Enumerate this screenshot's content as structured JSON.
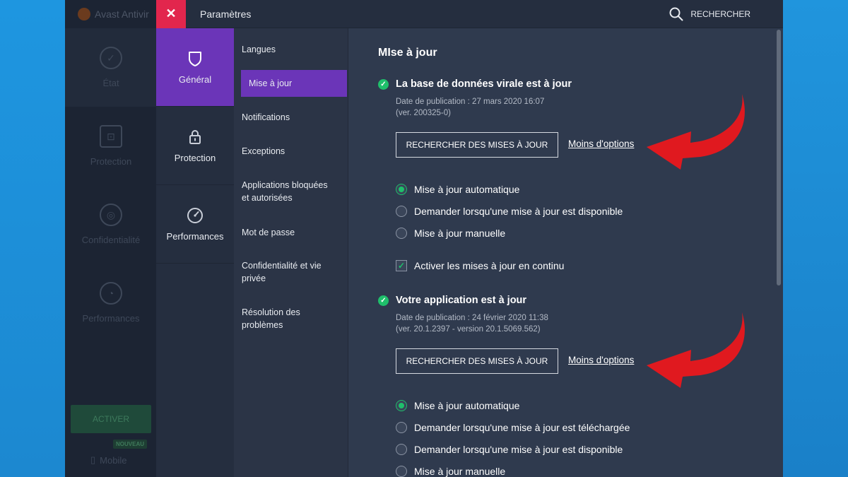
{
  "background_app": {
    "title": "Avast Antivir",
    "nav": [
      {
        "label": "État",
        "icon": "check-circle-icon"
      },
      {
        "label": "Protection",
        "icon": "lock-icon"
      },
      {
        "label": "Confidentialité",
        "icon": "fingerprint-icon"
      },
      {
        "label": "Performances",
        "icon": "speedometer-icon"
      }
    ],
    "activate_label": "ACTIVER",
    "new_badge": "NOUVEAU",
    "mobile_label": "Mobile"
  },
  "settings": {
    "title": "Paramètres",
    "search_label": "RECHERCHER",
    "close_symbol": "✕",
    "categories": [
      {
        "label": "Général",
        "icon": "shield-icon",
        "active": true
      },
      {
        "label": "Protection",
        "icon": "lock-icon",
        "active": false
      },
      {
        "label": "Performances",
        "icon": "speedometer-icon",
        "active": false
      }
    ],
    "subnav": [
      {
        "label": "Langues"
      },
      {
        "label": "Mise à jour",
        "active": true
      },
      {
        "label": "Notifications"
      },
      {
        "label": "Exceptions"
      },
      {
        "label": "Applications bloquées et autorisées"
      },
      {
        "label": "Mot de passe"
      },
      {
        "label": "Confidentialité et vie privée"
      },
      {
        "label": "Résolution des problèmes"
      }
    ],
    "content": {
      "heading": "MIse à jour",
      "virus_db": {
        "status": "La base de données virale est à jour",
        "date": "Date de publication : 27 mars 2020 16:07",
        "version": "(ver. 200325-0)",
        "button": "RECHERCHER DES MISES À JOUR",
        "less_options": "Moins d'options",
        "options": [
          {
            "label": "Mise à jour automatique",
            "selected": true
          },
          {
            "label": "Demander lorsqu'une mise à jour est disponible",
            "selected": false
          },
          {
            "label": "Mise à jour manuelle",
            "selected": false
          }
        ],
        "continuous": {
          "label": "Activer les mises à jour en continu",
          "checked": true
        }
      },
      "application": {
        "status": "Votre application est à jour",
        "date": "Date de publication : 24 février 2020 11:38",
        "version": "(ver. 20.1.2397 - version 20.1.5069.562)",
        "button": "RECHERCHER DES MISES À JOUR",
        "less_options": "Moins d'options",
        "options": [
          {
            "label": "Mise à jour automatique",
            "selected": true
          },
          {
            "label": "Demander lorsqu'une mise à jour est téléchargée",
            "selected": false
          },
          {
            "label": "Demander lorsqu'une mise à jour est disponible",
            "selected": false
          },
          {
            "label": "Mise à jour manuelle",
            "selected": false
          }
        ]
      }
    }
  },
  "colors": {
    "accent_purple": "#6b35b8",
    "close_red": "#e2264d",
    "success_green": "#1fbf6b",
    "arrow_red": "#e0191f"
  }
}
